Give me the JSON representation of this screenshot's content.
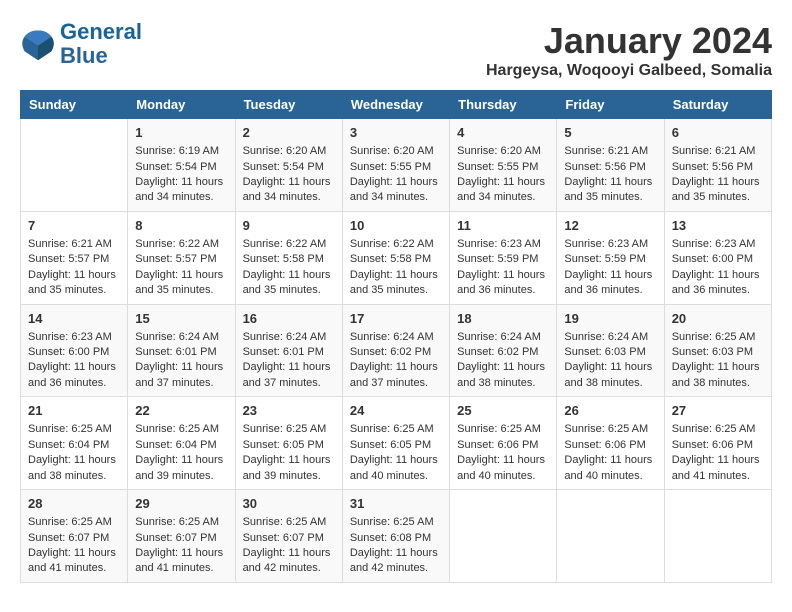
{
  "header": {
    "logo_line1": "General",
    "logo_line2": "Blue",
    "main_title": "January 2024",
    "subtitle": "Hargeysa, Woqooyi Galbeed, Somalia"
  },
  "days_of_week": [
    "Sunday",
    "Monday",
    "Tuesday",
    "Wednesday",
    "Thursday",
    "Friday",
    "Saturday"
  ],
  "weeks": [
    [
      {
        "day": "",
        "info": ""
      },
      {
        "day": "1",
        "info": "Sunrise: 6:19 AM\nSunset: 5:54 PM\nDaylight: 11 hours and 34 minutes."
      },
      {
        "day": "2",
        "info": "Sunrise: 6:20 AM\nSunset: 5:54 PM\nDaylight: 11 hours and 34 minutes."
      },
      {
        "day": "3",
        "info": "Sunrise: 6:20 AM\nSunset: 5:55 PM\nDaylight: 11 hours and 34 minutes."
      },
      {
        "day": "4",
        "info": "Sunrise: 6:20 AM\nSunset: 5:55 PM\nDaylight: 11 hours and 34 minutes."
      },
      {
        "day": "5",
        "info": "Sunrise: 6:21 AM\nSunset: 5:56 PM\nDaylight: 11 hours and 35 minutes."
      },
      {
        "day": "6",
        "info": "Sunrise: 6:21 AM\nSunset: 5:56 PM\nDaylight: 11 hours and 35 minutes."
      }
    ],
    [
      {
        "day": "7",
        "info": "Sunrise: 6:21 AM\nSunset: 5:57 PM\nDaylight: 11 hours and 35 minutes."
      },
      {
        "day": "8",
        "info": "Sunrise: 6:22 AM\nSunset: 5:57 PM\nDaylight: 11 hours and 35 minutes."
      },
      {
        "day": "9",
        "info": "Sunrise: 6:22 AM\nSunset: 5:58 PM\nDaylight: 11 hours and 35 minutes."
      },
      {
        "day": "10",
        "info": "Sunrise: 6:22 AM\nSunset: 5:58 PM\nDaylight: 11 hours and 35 minutes."
      },
      {
        "day": "11",
        "info": "Sunrise: 6:23 AM\nSunset: 5:59 PM\nDaylight: 11 hours and 36 minutes."
      },
      {
        "day": "12",
        "info": "Sunrise: 6:23 AM\nSunset: 5:59 PM\nDaylight: 11 hours and 36 minutes."
      },
      {
        "day": "13",
        "info": "Sunrise: 6:23 AM\nSunset: 6:00 PM\nDaylight: 11 hours and 36 minutes."
      }
    ],
    [
      {
        "day": "14",
        "info": "Sunrise: 6:23 AM\nSunset: 6:00 PM\nDaylight: 11 hours and 36 minutes."
      },
      {
        "day": "15",
        "info": "Sunrise: 6:24 AM\nSunset: 6:01 PM\nDaylight: 11 hours and 37 minutes."
      },
      {
        "day": "16",
        "info": "Sunrise: 6:24 AM\nSunset: 6:01 PM\nDaylight: 11 hours and 37 minutes."
      },
      {
        "day": "17",
        "info": "Sunrise: 6:24 AM\nSunset: 6:02 PM\nDaylight: 11 hours and 37 minutes."
      },
      {
        "day": "18",
        "info": "Sunrise: 6:24 AM\nSunset: 6:02 PM\nDaylight: 11 hours and 38 minutes."
      },
      {
        "day": "19",
        "info": "Sunrise: 6:24 AM\nSunset: 6:03 PM\nDaylight: 11 hours and 38 minutes."
      },
      {
        "day": "20",
        "info": "Sunrise: 6:25 AM\nSunset: 6:03 PM\nDaylight: 11 hours and 38 minutes."
      }
    ],
    [
      {
        "day": "21",
        "info": "Sunrise: 6:25 AM\nSunset: 6:04 PM\nDaylight: 11 hours and 38 minutes."
      },
      {
        "day": "22",
        "info": "Sunrise: 6:25 AM\nSunset: 6:04 PM\nDaylight: 11 hours and 39 minutes."
      },
      {
        "day": "23",
        "info": "Sunrise: 6:25 AM\nSunset: 6:05 PM\nDaylight: 11 hours and 39 minutes."
      },
      {
        "day": "24",
        "info": "Sunrise: 6:25 AM\nSunset: 6:05 PM\nDaylight: 11 hours and 40 minutes."
      },
      {
        "day": "25",
        "info": "Sunrise: 6:25 AM\nSunset: 6:06 PM\nDaylight: 11 hours and 40 minutes."
      },
      {
        "day": "26",
        "info": "Sunrise: 6:25 AM\nSunset: 6:06 PM\nDaylight: 11 hours and 40 minutes."
      },
      {
        "day": "27",
        "info": "Sunrise: 6:25 AM\nSunset: 6:06 PM\nDaylight: 11 hours and 41 minutes."
      }
    ],
    [
      {
        "day": "28",
        "info": "Sunrise: 6:25 AM\nSunset: 6:07 PM\nDaylight: 11 hours and 41 minutes."
      },
      {
        "day": "29",
        "info": "Sunrise: 6:25 AM\nSunset: 6:07 PM\nDaylight: 11 hours and 41 minutes."
      },
      {
        "day": "30",
        "info": "Sunrise: 6:25 AM\nSunset: 6:07 PM\nDaylight: 11 hours and 42 minutes."
      },
      {
        "day": "31",
        "info": "Sunrise: 6:25 AM\nSunset: 6:08 PM\nDaylight: 11 hours and 42 minutes."
      },
      {
        "day": "",
        "info": ""
      },
      {
        "day": "",
        "info": ""
      },
      {
        "day": "",
        "info": ""
      }
    ]
  ]
}
